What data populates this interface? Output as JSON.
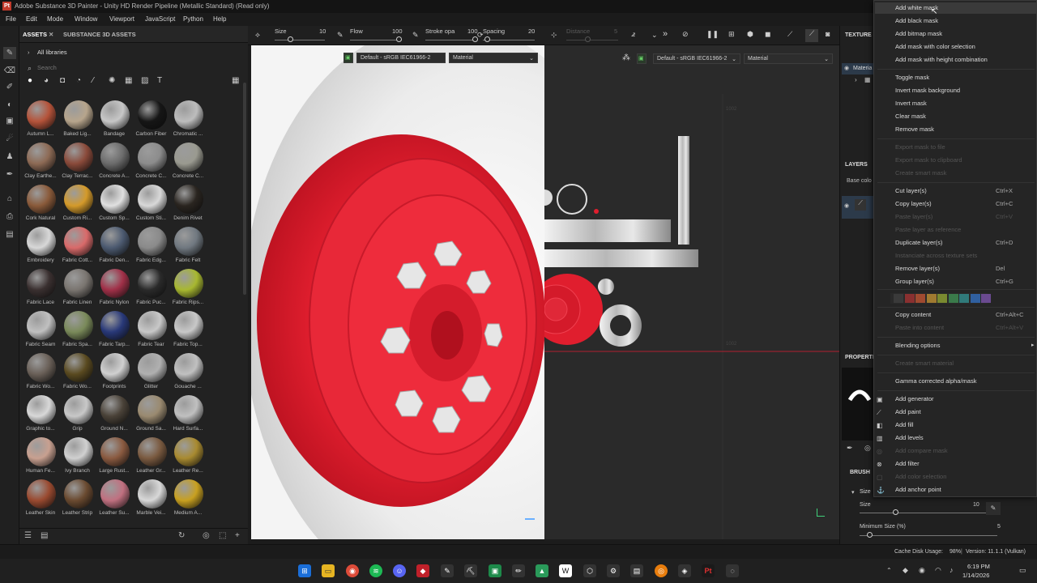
{
  "window": {
    "title": "Adobe Substance 3D Painter - Unity HD Render Pipeline (Metallic Standard) (Read only)"
  },
  "menu": [
    "File",
    "Edit",
    "Mode",
    "Window",
    "Viewport",
    "JavaScript",
    "Python",
    "Help"
  ],
  "assets": {
    "tab_assets": "ASSETS",
    "tab_substance": "SUBSTANCE 3D ASSETS",
    "all_libraries": "All libraries",
    "search_placeholder": "Search",
    "materials": [
      {
        "name": "Autumn L...",
        "color": "#b5533a"
      },
      {
        "name": "Baked Lig...",
        "color": "#b7a58c"
      },
      {
        "name": "Bandage",
        "color": "#c7c7c7"
      },
      {
        "name": "Carbon Fiber",
        "color": "#161616"
      },
      {
        "name": "Chromatic ...",
        "color": "#bdbdbd"
      },
      {
        "name": "Clay Earthe...",
        "color": "#8d6a55"
      },
      {
        "name": "Clay Terrac...",
        "color": "#8a4a3a"
      },
      {
        "name": "Concrete A...",
        "color": "#6c6c6c"
      },
      {
        "name": "Concrete C...",
        "color": "#8c8c8c"
      },
      {
        "name": "Concrete C...",
        "color": "#9a9a90"
      },
      {
        "name": "Cork Natural",
        "color": "#8a5a3a"
      },
      {
        "name": "Custom Ri...",
        "color": "#d49a2a"
      },
      {
        "name": "Custom Sp...",
        "color": "#e0e0e0"
      },
      {
        "name": "Custom Sti...",
        "color": "#d8d8d8"
      },
      {
        "name": "Denim Rivet",
        "color": "#2a2520"
      },
      {
        "name": "Embroidery",
        "color": "#d8d8d8"
      },
      {
        "name": "Fabric Cott...",
        "color": "#d96a6a"
      },
      {
        "name": "Fabric Den...",
        "color": "#4c5a70"
      },
      {
        "name": "Fabric Edg...",
        "color": "#8a8a8a"
      },
      {
        "name": "Fabric Felt",
        "color": "#707880"
      },
      {
        "name": "Fabric Lace",
        "color": "#3a3030"
      },
      {
        "name": "Fabric Linen",
        "color": "#7a7570"
      },
      {
        "name": "Fabric Nylon",
        "color": "#a03048"
      },
      {
        "name": "Fabric Puc...",
        "color": "#2a2a2a"
      },
      {
        "name": "Fabric Rips...",
        "color": "#a8b830"
      },
      {
        "name": "Fabric Seam",
        "color": "#c0c0c0"
      },
      {
        "name": "Fabric Spa...",
        "color": "#7a8a5a"
      },
      {
        "name": "Fabric Tarp...",
        "color": "#283878"
      },
      {
        "name": "Fabric Tear",
        "color": "#c8c8c8"
      },
      {
        "name": "Fabric Top...",
        "color": "#c8c8c8"
      },
      {
        "name": "Fabric Wo...",
        "color": "#6a6058"
      },
      {
        "name": "Fabric Wo...",
        "color": "#5a4a20"
      },
      {
        "name": "Footprints",
        "color": "#d0d0d0"
      },
      {
        "name": "Glitter",
        "color": "#b0b0b0"
      },
      {
        "name": "Gouache ...",
        "color": "#c0c0c0"
      },
      {
        "name": "Graphic to...",
        "color": "#d8d8d8"
      },
      {
        "name": "Grip",
        "color": "#c8c8c8"
      },
      {
        "name": "Ground N...",
        "color": "#4a4238"
      },
      {
        "name": "Ground Sa...",
        "color": "#9a8a70"
      },
      {
        "name": "Hard Surfa...",
        "color": "#c0c0c0"
      },
      {
        "name": "Human Fe...",
        "color": "#c8a090"
      },
      {
        "name": "Ivy Branch",
        "color": "#d0d0d0"
      },
      {
        "name": "Large Rust...",
        "color": "#8a5a40"
      },
      {
        "name": "Leather Gr...",
        "color": "#7a5a40"
      },
      {
        "name": "Leather Re...",
        "color": "#a88a30"
      },
      {
        "name": "Leather Skin",
        "color": "#9a4a30"
      },
      {
        "name": "Leather Strip",
        "color": "#6a4a30"
      },
      {
        "name": "Leather Su...",
        "color": "#c07080"
      },
      {
        "name": "Marble Vei...",
        "color": "#d8d8d8"
      },
      {
        "name": "Medium A...",
        "color": "#c8a020"
      }
    ]
  },
  "toolbar": {
    "size_label": "Size",
    "size_value": "10",
    "flow_label": "Flow",
    "flow_value": "100",
    "stroke_label": "Stroke opa",
    "stroke_value": "100",
    "spacing_label": "Spacing",
    "spacing_value": "20",
    "distance_label": "Distance",
    "distance_value": "5",
    "vp1_colorspace": "Default - sRGB IEC61966-2",
    "vp1_material": "Material",
    "vp2_colorspace": "Default - sRGB IEC61966-2",
    "vp2_material": "Material"
  },
  "viewport2d": {
    "label_top": "1002",
    "label_mid": "1002"
  },
  "right": {
    "texture_set": "TEXTURE S",
    "material_item": "Materia",
    "layers": "LAYERS",
    "base_color": "Base colo",
    "properties": "PROPERTI",
    "brush": "BRUSH",
    "size_section": "Size",
    "size_label": "Size",
    "size_value": "10",
    "min_size_label": "Minimum Size (%)",
    "min_size_value": "5"
  },
  "context_menu": {
    "items": [
      {
        "label": "Add white mask",
        "disabled": false,
        "highlight": true
      },
      {
        "label": "Add black mask",
        "disabled": false
      },
      {
        "label": "Add bitmap mask",
        "disabled": false
      },
      {
        "label": "Add mask with color selection",
        "disabled": false
      },
      {
        "label": "Add mask with height combination",
        "disabled": false
      },
      {
        "label": "Toggle mask",
        "disabled": false
      },
      {
        "label": "Invert mask background",
        "disabled": false
      },
      {
        "label": "Invert mask",
        "disabled": false
      },
      {
        "label": "Clear mask",
        "disabled": false
      },
      {
        "label": "Remove mask",
        "disabled": false
      },
      {
        "label": "Export mask to file",
        "disabled": true
      },
      {
        "label": "Export mask to clipboard",
        "disabled": true
      },
      {
        "label": "Create smart mask",
        "disabled": true
      },
      {
        "label": "Cut layer(s)",
        "shortcut": "Ctrl+X",
        "disabled": false
      },
      {
        "label": "Copy layer(s)",
        "shortcut": "Ctrl+C",
        "disabled": false
      },
      {
        "label": "Paste layer(s)",
        "shortcut": "Ctrl+V",
        "disabled": true
      },
      {
        "label": "Paste layer as reference",
        "disabled": true
      },
      {
        "label": "Duplicate layer(s)",
        "shortcut": "Ctrl+D",
        "disabled": false
      },
      {
        "label": "Instanciate across texture sets",
        "disabled": true
      },
      {
        "label": "Remove layer(s)",
        "shortcut": "Del",
        "disabled": false
      },
      {
        "label": "Group layer(s)",
        "shortcut": "Ctrl+G",
        "disabled": false
      },
      {
        "label": "Copy content",
        "shortcut": "Ctrl+Alt+C",
        "disabled": false
      },
      {
        "label": "Paste into content",
        "shortcut": "Ctrl+Alt+V",
        "disabled": true
      },
      {
        "label": "Blending options",
        "disabled": false
      },
      {
        "label": "Create smart material",
        "disabled": true
      },
      {
        "label": "Gamma corrected alpha/mask",
        "disabled": false
      },
      {
        "label": "Add generator",
        "disabled": false
      },
      {
        "label": "Add paint",
        "disabled": false
      },
      {
        "label": "Add fill",
        "disabled": false
      },
      {
        "label": "Add levels",
        "disabled": false
      },
      {
        "label": "Add compare mask",
        "disabled": true
      },
      {
        "label": "Add filter",
        "disabled": false
      },
      {
        "label": "Add color selection",
        "disabled": true
      },
      {
        "label": "Add anchor point",
        "disabled": false
      }
    ],
    "swatches": [
      "#3a3a3a",
      "#8a3030",
      "#a04a30",
      "#a07a30",
      "#7a8a30",
      "#3a7a4a",
      "#307a7a",
      "#3060a0",
      "#6a4a90"
    ]
  },
  "status": {
    "cache": "Cache Disk Usage:",
    "cache_value": "98%",
    "version": "Version: 11.1.1 (Vulkan)"
  },
  "taskbar": {
    "time": "6:19 PM",
    "date": "1/14/2026"
  }
}
